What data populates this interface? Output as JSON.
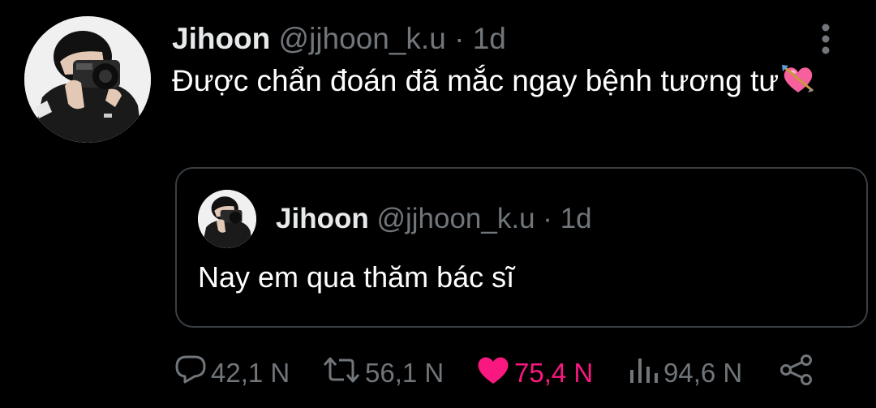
{
  "tweet": {
    "author_name": "Jihoon",
    "handle": "@jjhoon_k.u",
    "separator": "·",
    "time": "1d",
    "text": "Được chẩn đoán đã mắc ngay bệnh tương tư",
    "emoji": "heart-with-arrow"
  },
  "quoted_tweet": {
    "author_name": "Jihoon",
    "handle": "@jjhoon_k.u",
    "separator": "·",
    "time": "1d",
    "text": "Nay em qua thăm bác sĩ"
  },
  "actions": {
    "replies": "42,1 N",
    "retweets": "56,1 N",
    "likes": "75,4 N",
    "views": "94,6 N",
    "liked": true
  },
  "colors": {
    "background": "#000000",
    "text_primary": "#e7e9ea",
    "text_muted": "#71767b",
    "like_accent": "#f91880",
    "quote_border": "#3a3f44"
  }
}
